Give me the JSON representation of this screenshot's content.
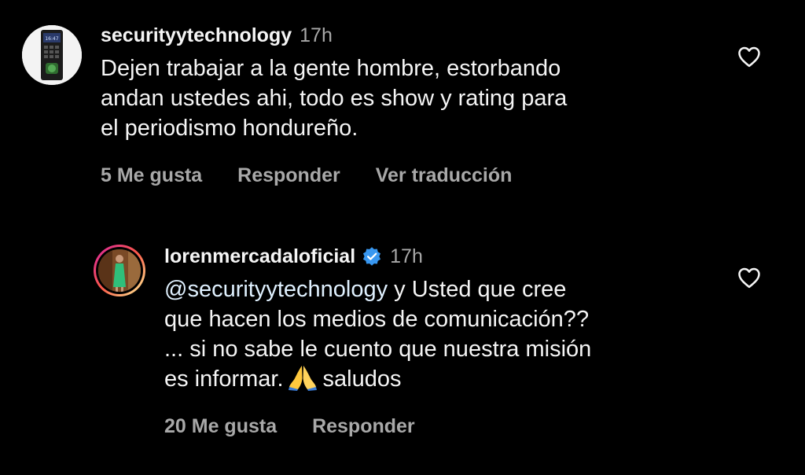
{
  "comments": [
    {
      "username": "securityytechnology",
      "time": "17h",
      "lines": [
        "Dejen trabajar a la gente hombre, estorbando",
        "andan ustedes ahi, todo es show y rating para",
        "el periodismo hondureño."
      ],
      "likes_label": "5 Me gusta",
      "reply_label": "Responder",
      "translate_label": "Ver traducción",
      "avatar_screen_text": "16:47"
    },
    {
      "username": "lorenmercadaloficial",
      "time": "17h",
      "verified": true,
      "mention": "@securityytechnology",
      "line1_rest": " y Usted que cree",
      "line2": "que hacen los medios de comunicación??",
      "line3": "... si no sabe le cuento que nuestra misión",
      "line4_before": "es informar.",
      "line4_after": "saludos",
      "emoji": "folded-hands",
      "likes_label": "20 Me gusta",
      "reply_label": "Responder"
    }
  ],
  "colors": {
    "background": "#000000",
    "text": "#f5f5f5",
    "muted": "#a8a8a8",
    "verified": "#3897f0"
  }
}
